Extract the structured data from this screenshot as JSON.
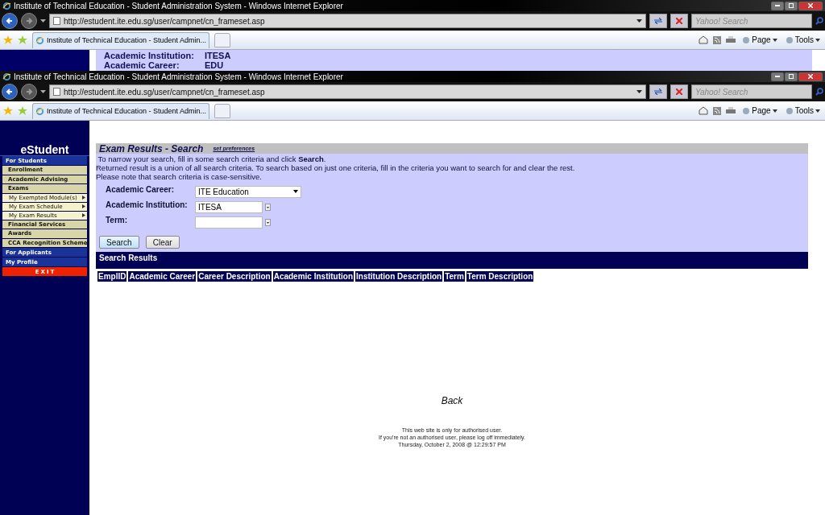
{
  "background_window": {
    "title": "Institute of Technical Education - Student Administration System - Windows Internet Explorer",
    "address": "http://estudent.ite.edu.sg/user/campnet/cn_frameset.asp",
    "search_placeholder": "Yahoo! Search",
    "tab_label": "Institute of Technical Education - Student Admin...",
    "toolbar": [
      "Page",
      "Tools"
    ],
    "peek": [
      {
        "label": "Academic Institution:",
        "value": "ITESA"
      },
      {
        "label": "Academic Career:",
        "value": "EDU"
      }
    ]
  },
  "window": {
    "title": "Institute of Technical Education - Student Administration System - Windows Internet Explorer",
    "address": "http://estudent.ite.edu.sg/user/campnet/cn_frameset.asp",
    "search_placeholder": "Yahoo! Search",
    "tab_label": "Institute of Technical Education - Student Admin...",
    "toolbar": [
      "Page",
      "Tools"
    ]
  },
  "sidebar": {
    "title": "eStudent",
    "items": [
      {
        "label": "For Students",
        "kind": "section"
      },
      {
        "label": "Enrollment",
        "kind": "item"
      },
      {
        "label": "Academic Advising",
        "kind": "item"
      },
      {
        "label": "Exams",
        "kind": "item"
      },
      {
        "label": "My Exempted Module(s)",
        "kind": "subitem"
      },
      {
        "label": "My Exam Schedule",
        "kind": "subitem"
      },
      {
        "label": "My Exam Results",
        "kind": "subitem"
      },
      {
        "label": "Financial Services",
        "kind": "item"
      },
      {
        "label": "Awards",
        "kind": "item"
      },
      {
        "label": "CCA Recognition Scheme",
        "kind": "item"
      },
      {
        "label": "For Applicants",
        "kind": "section"
      },
      {
        "label": "My Profile",
        "kind": "section"
      },
      {
        "label": "EXIT",
        "kind": "exit"
      }
    ]
  },
  "page": {
    "title": "Exam Results - Search",
    "preferences_link": "set preferences",
    "instructions": [
      " To narrow your search, fill in some search criteria and click **Search**.",
      "Returned result is a union of all search criteria. To search based on just one criteria, fill in the criteria you want to search for and clear the rest.",
      "Please note that search criteria is case-sensitive."
    ],
    "fields": [
      {
        "label": "Academic Career:",
        "value": "ITE Education",
        "kind": "dropdown"
      },
      {
        "label": "Academic Institution:",
        "value": "ITESA",
        "kind": "combo"
      },
      {
        "label": "Term:",
        "kind": "combo"
      }
    ],
    "buttons": [
      {
        "label": "Search",
        "selected": true
      },
      {
        "label": "Clear",
        "selected": false
      }
    ],
    "results_title": "Search Results",
    "columns": [
      "EmplID",
      "Academic Career",
      "Career Description",
      "Academic Institution",
      "Institution Description",
      "Term",
      "Term Description"
    ],
    "back_link": "Back",
    "footer": [
      "This web site is only for authorised user.",
      "If you're not an authorised user, please log off immediately.",
      "Thursday, October 2, 2008 @ 12:29:57 PM"
    ]
  }
}
